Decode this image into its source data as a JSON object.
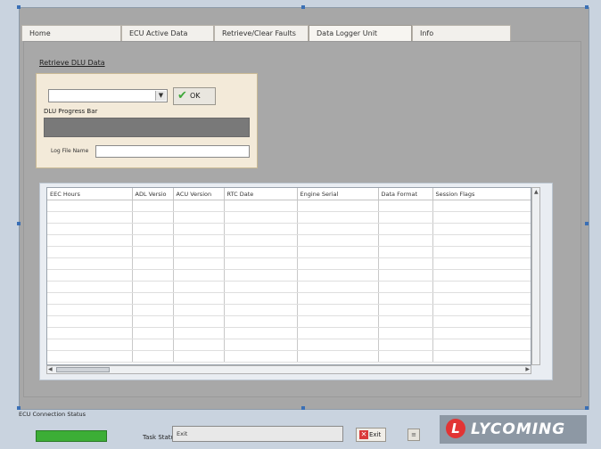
{
  "tabs": [
    {
      "label": "Home",
      "active": false
    },
    {
      "label": "ECU Active Data",
      "active": false
    },
    {
      "label": "Retrieve/Clear Faults",
      "active": false
    },
    {
      "label": "Data Logger Unit",
      "active": true
    },
    {
      "label": "Info",
      "active": false
    }
  ],
  "retrieve": {
    "title": "Retrieve DLU Data",
    "select_value": "",
    "ok_label": "OK",
    "progress_label": "DLU Progress Bar",
    "progress_value": 0,
    "logfile_label": "Log File Name",
    "logfile_value": ""
  },
  "table": {
    "columns": [
      "EEC Hours",
      "ADL Versio",
      "ACU Version",
      "RTC Date",
      "Engine Serial",
      "Data Format",
      "Session Flags"
    ]
  },
  "footer": {
    "connection_label": "ECU Connection Status",
    "connection_value": "Connected",
    "connection_color": "#3cae36",
    "task_status_label": "Task Status",
    "task_status_value": "Exit",
    "exit_label": "Exit",
    "logo_text": "LYCOMING",
    "logo_color": "#e23434"
  }
}
